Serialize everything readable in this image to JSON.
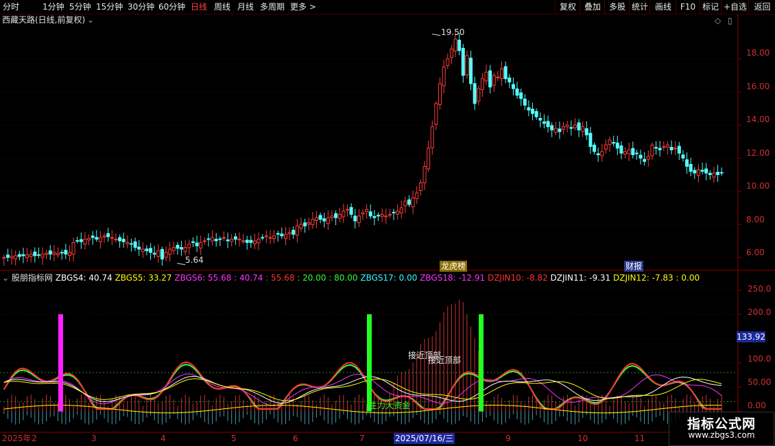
{
  "toolbar": {
    "periods": [
      "分时",
      "1分钟",
      "5分钟",
      "15分钟",
      "30分钟",
      "60分钟",
      "日线",
      "周线",
      "月线",
      "多周期",
      "更多 >"
    ],
    "active": "日线",
    "right_buttons": [
      "复权",
      "叠加",
      "多股",
      "统计",
      "画线",
      "F10",
      "标记",
      "+自选",
      "返回"
    ]
  },
  "main_chart": {
    "title": "西藏天路(日线,前复权)",
    "high_label": "19.50",
    "low_label": "5.64",
    "y_ticks": [
      "18.00",
      "16.00",
      "14.00",
      "12.00",
      "10.00",
      "8.00",
      "6.00"
    ],
    "y_range": [
      5.3,
      19.9
    ],
    "event_tags": [
      "龙虎榜",
      "财报"
    ]
  },
  "indicator": {
    "name": "股朋指标网",
    "readouts": [
      {
        "text": "ZBGS4: 40.74",
        "color": "#ffffff"
      },
      {
        "text": "ZBGS5: 33.27",
        "color": "#ffff00"
      },
      {
        "text": "ZBGS6: 55.68",
        "color": "#ff33ff"
      },
      {
        "text": ": 40.74",
        "color": "#ff33ff"
      },
      {
        "text": ": 55.68",
        "color": "#ff3333"
      },
      {
        "text": ": 20.00",
        "color": "#33ff33"
      },
      {
        "text": ": 80.00",
        "color": "#33ff33"
      },
      {
        "text": "ZBGS17: 0.00",
        "color": "#33ffff"
      },
      {
        "text": "ZBGS18: -12.91",
        "color": "#ff33ff"
      },
      {
        "text": "DZJIN10: -8.82",
        "color": "#ff3333"
      },
      {
        "text": "DZJIN11: -9.31",
        "color": "#ffffff"
      },
      {
        "text": "DZJIN12: -7.83",
        "color": "#ffff00"
      },
      {
        "text": ": 0.00",
        "color": "#ffff00"
      }
    ],
    "y_ticks": [
      "250.0",
      "200.0",
      "150.0",
      "100.0",
      "50.00",
      "0.00"
    ],
    "y_range": [
      -40,
      265
    ],
    "current_value": "133.92",
    "annotations": [
      "接近顶部",
      "接近顶部",
      "主力大资金"
    ]
  },
  "date_axis": {
    "year_label": "2025年",
    "months": [
      "2",
      "3",
      "4",
      "5",
      "6",
      "7",
      "8",
      "9",
      "10",
      "11"
    ],
    "cursor_date": "2025/07/16/三"
  },
  "watermark": {
    "title": "指标公式网",
    "url": "www.zbgs3.com"
  },
  "chart_data": [
    {
      "type": "candlestick",
      "title": "西藏天路(日线,前复权)",
      "x_range": [
        "2025-01",
        "2025-11"
      ],
      "ylim": [
        5.3,
        19.9
      ],
      "close": [
        6.0,
        6.0,
        6.05,
        6.1,
        6.05,
        6.1,
        6.15,
        6.2,
        6.1,
        6.15,
        6.2,
        6.25,
        6.2,
        6.3,
        6.25,
        6.3,
        6.2,
        6.3,
        6.9,
        7.0,
        6.95,
        7.1,
        7.15,
        7.2,
        7.1,
        7.2,
        7.3,
        7.25,
        7.2,
        7.1,
        7.0,
        6.95,
        6.9,
        6.8,
        6.6,
        6.5,
        6.5,
        6.4,
        6.3,
        6.2,
        6.4,
        5.9,
        6.3,
        6.5,
        6.6,
        6.55,
        6.5,
        6.6,
        6.8,
        6.9,
        6.7,
        6.9,
        7.0,
        7.1,
        7.2,
        7.0,
        7.1,
        7.2,
        7.0,
        7.1,
        7.1,
        7.1,
        7.0,
        6.9,
        6.9,
        7.0,
        7.1,
        7.2,
        7.3,
        7.2,
        7.3,
        7.4,
        7.3,
        7.4,
        7.5,
        7.4,
        7.9,
        8.0,
        7.9,
        8.1,
        8.3,
        8.4,
        8.3,
        8.2,
        8.4,
        8.5,
        8.4,
        8.6,
        8.8,
        8.9,
        8.6,
        8.2,
        8.5,
        8.7,
        8.9,
        8.5,
        8.4,
        8.5,
        8.6,
        8.5,
        8.6,
        8.7,
        8.8,
        9.0,
        9.4,
        9.2,
        9.6,
        9.9,
        10.5,
        11.5,
        12.6,
        13.9,
        15.3,
        16.5,
        17.5,
        18.0,
        18.6,
        19.2,
        18.5,
        17.0,
        18.2,
        16.5,
        15.3,
        16.2,
        16.8,
        17.2,
        16.3,
        17.0,
        16.9,
        17.4,
        16.8,
        16.6,
        16.2,
        15.8,
        15.6,
        15.2,
        14.9,
        14.7,
        14.5,
        14.3,
        14.1,
        13.9,
        13.7,
        13.8,
        13.6,
        13.9,
        14.0,
        13.8,
        14.0,
        13.7,
        13.9,
        13.4,
        12.7,
        12.4,
        12.2,
        12.4,
        12.8,
        13.1,
        12.9,
        12.6,
        12.3,
        12.4,
        12.5,
        12.2,
        12.3,
        12.0,
        11.8,
        12.1,
        12.8,
        12.6,
        12.5,
        12.7,
        12.8,
        12.5,
        12.6,
        12.3,
        12.0,
        11.5,
        11.2,
        11.1,
        11.3,
        11.2,
        11.1,
        11.0,
        11.1,
        11.0,
        11.1
      ]
    },
    {
      "type": "line",
      "title": "股朋指标网",
      "ylim": [
        -40,
        265
      ],
      "series": [
        {
          "name": "ZBGS4",
          "values": [
            40.74
          ]
        },
        {
          "name": "ZBGS5",
          "values": [
            33.27
          ]
        },
        {
          "name": "ZBGS6",
          "values": [
            55.68
          ]
        },
        {
          "name": "ZBGS17",
          "values": [
            0.0
          ]
        },
        {
          "name": "ZBGS18",
          "values": [
            -12.91
          ]
        },
        {
          "name": "DZJIN10",
          "values": [
            -8.82
          ]
        },
        {
          "name": "DZJIN11",
          "values": [
            -9.31
          ]
        },
        {
          "name": "DZJIN12",
          "values": [
            -7.83
          ]
        }
      ]
    }
  ],
  "colors": {
    "up": "#ff3c3c",
    "down": "#54ffff",
    "grid": "#5a0000",
    "axis": "#8b0000",
    "label": "#d03030"
  }
}
